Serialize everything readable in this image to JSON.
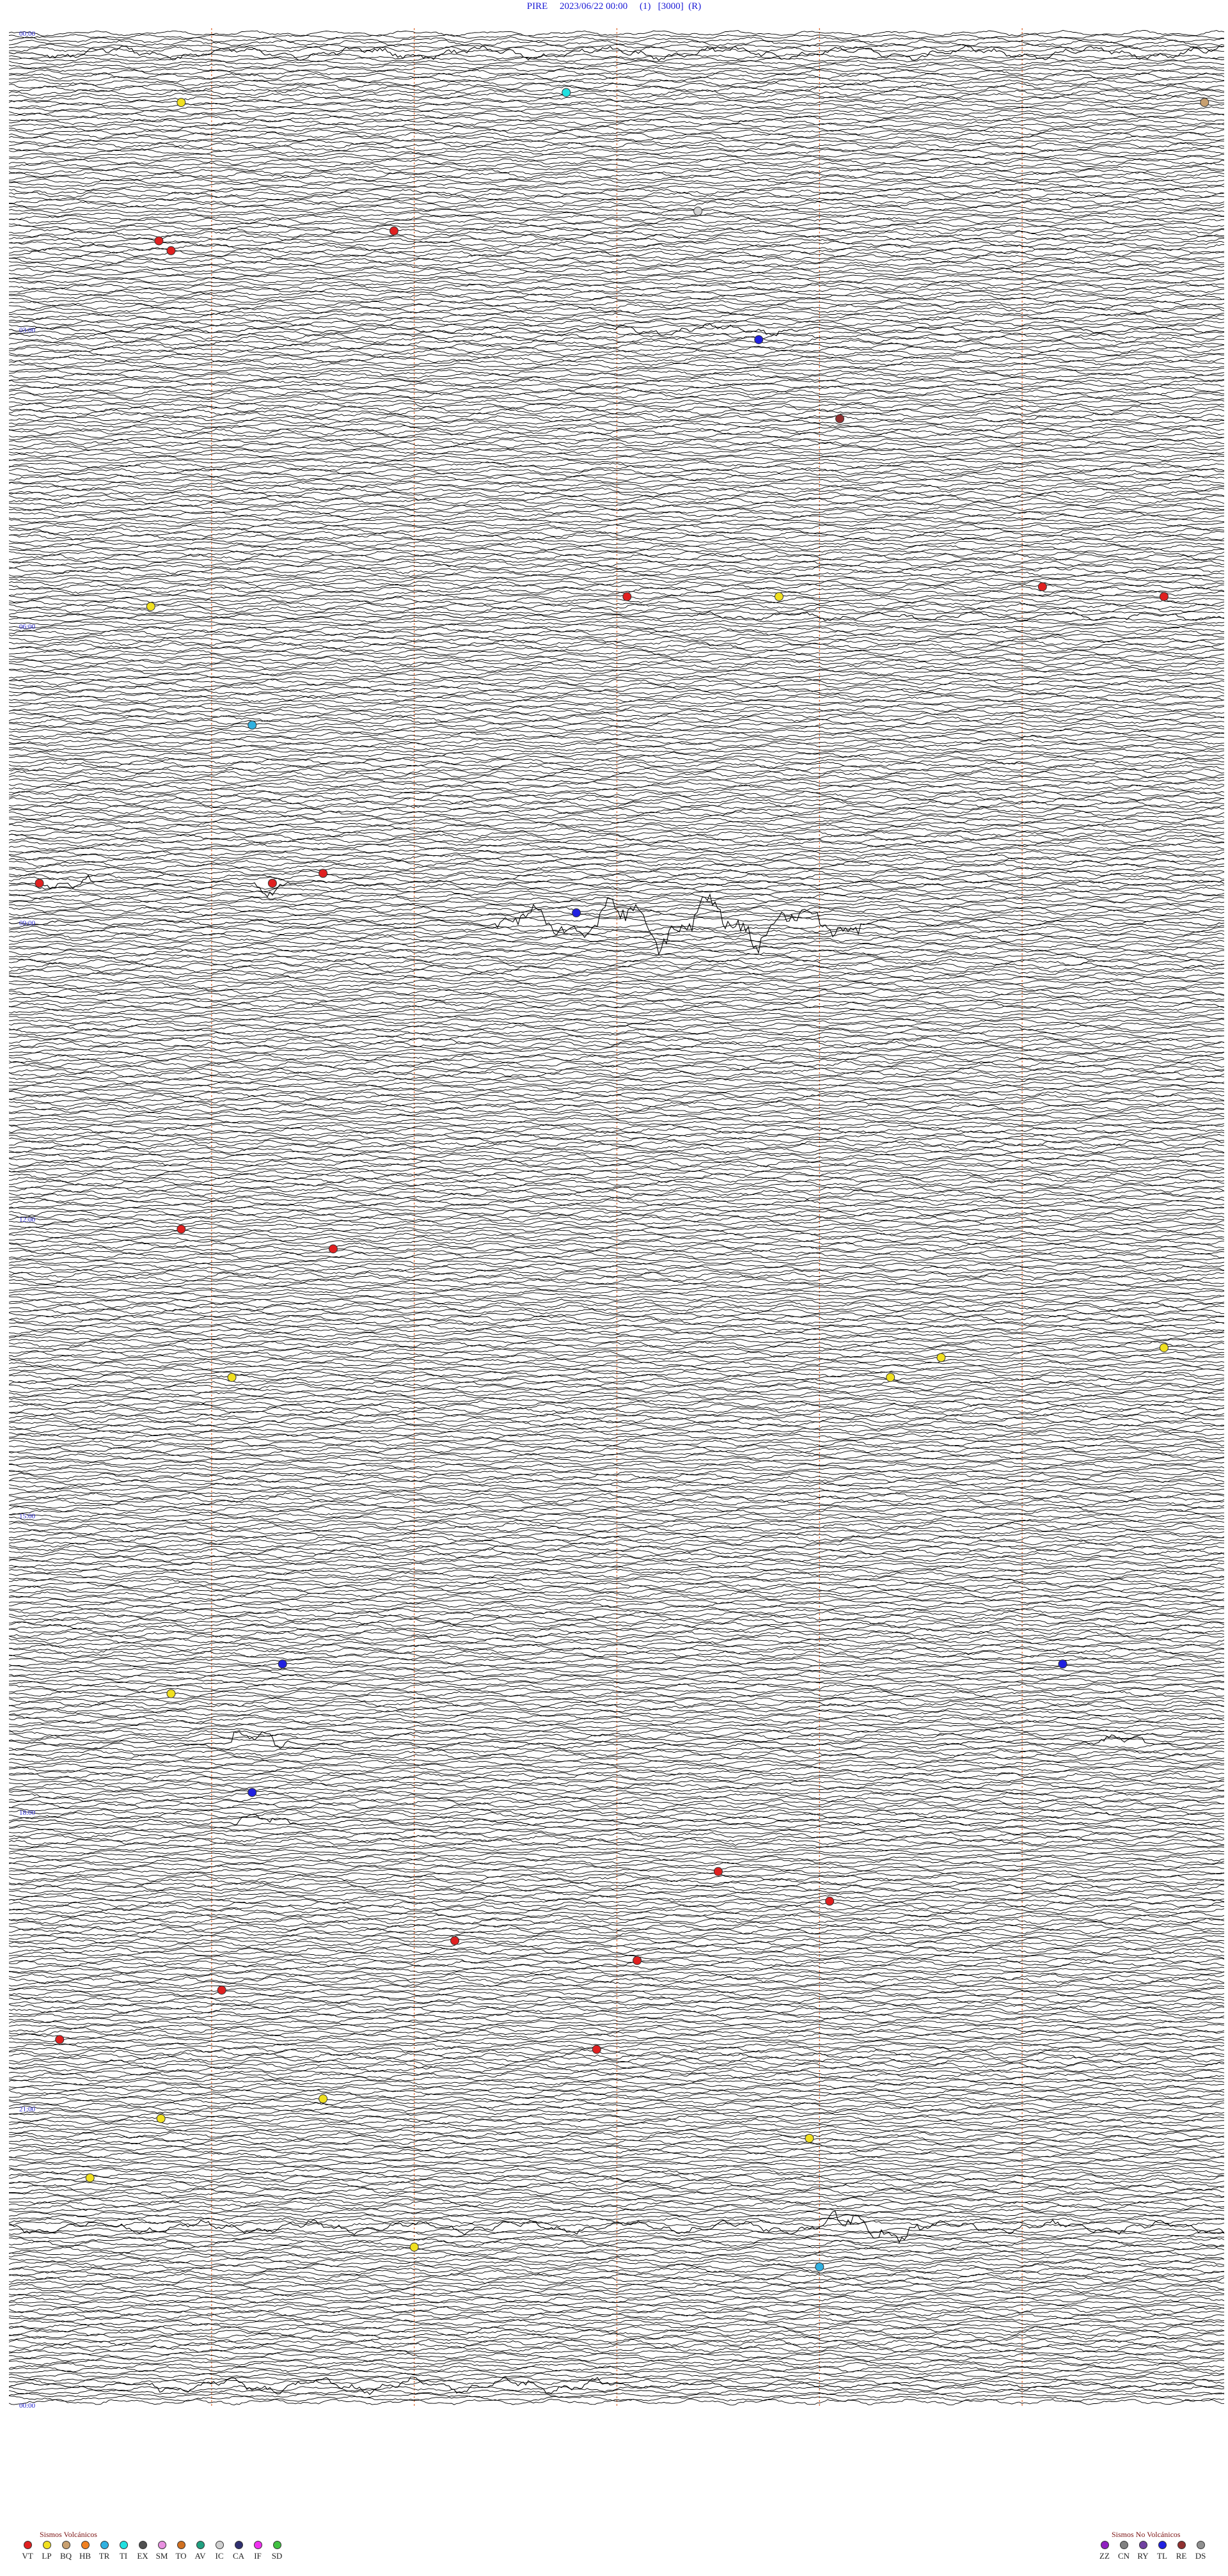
{
  "header": {
    "station": "PIRE",
    "datetime": "2023/06/22 00:00",
    "channel": "(1)",
    "gain": "[3000]",
    "mode": "(R)"
  },
  "chart_data": {
    "type": "seismogram-helicorder",
    "hour_labels": [
      "00:00",
      "03:00",
      "06:00",
      "09:00",
      "12:00",
      "15:00",
      "18:00",
      "21:00",
      "00:00"
    ],
    "grid_color": "#e0703a",
    "trace_color": "#000000",
    "events": [
      {
        "hour": 0.6,
        "minute": 27.5,
        "type": "TI"
      },
      {
        "hour": 0.7,
        "minute": 8.5,
        "type": "LP"
      },
      {
        "hour": 0.7,
        "minute": 59.0,
        "type": "BQ"
      },
      {
        "hour": 2.1,
        "minute": 7.4,
        "type": "VT"
      },
      {
        "hour": 2.2,
        "minute": 8.0,
        "type": "VT"
      },
      {
        "hour": 2.0,
        "minute": 19.0,
        "type": "VT"
      },
      {
        "hour": 1.8,
        "minute": 34.0,
        "type": "IC"
      },
      {
        "hour": 3.1,
        "minute": 37.0,
        "type": "TL"
      },
      {
        "hour": 3.9,
        "minute": 41.0,
        "type": "RE"
      },
      {
        "hour": 5.6,
        "minute": 51.0,
        "type": "VT"
      },
      {
        "hour": 5.7,
        "minute": 38.0,
        "type": "LP"
      },
      {
        "hour": 5.8,
        "minute": 7.0,
        "type": "LP"
      },
      {
        "hour": 5.7,
        "minute": 57.0,
        "type": "VT"
      },
      {
        "hour": 5.7,
        "minute": 30.5,
        "type": "VT"
      },
      {
        "hour": 7.0,
        "minute": 12.0,
        "type": "TR"
      },
      {
        "hour": 8.6,
        "minute": 1.5,
        "type": "VT"
      },
      {
        "hour": 8.6,
        "minute": 13.0,
        "type": "VT"
      },
      {
        "hour": 8.5,
        "minute": 15.5,
        "type": "VT"
      },
      {
        "hour": 8.9,
        "minute": 28.0,
        "type": "TL"
      },
      {
        "hour": 12.1,
        "minute": 8.5,
        "type": "VT"
      },
      {
        "hour": 12.3,
        "minute": 16.0,
        "type": "VT"
      },
      {
        "hour": 13.3,
        "minute": 57.0,
        "type": "LP"
      },
      {
        "hour": 13.4,
        "minute": 46.0,
        "type": "LP"
      },
      {
        "hour": 13.6,
        "minute": 11.0,
        "type": "LP"
      },
      {
        "hour": 13.6,
        "minute": 43.5,
        "type": "LP"
      },
      {
        "hour": 16.5,
        "minute": 13.5,
        "type": "TL"
      },
      {
        "hour": 16.5,
        "minute": 52.0,
        "type": "TL"
      },
      {
        "hour": 16.8,
        "minute": 8.0,
        "type": "LP"
      },
      {
        "hour": 17.8,
        "minute": 12.0,
        "type": "TL"
      },
      {
        "hour": 18.6,
        "minute": 35.0,
        "type": "VT"
      },
      {
        "hour": 18.9,
        "minute": 40.5,
        "type": "VT"
      },
      {
        "hour": 19.3,
        "minute": 22.0,
        "type": "VT"
      },
      {
        "hour": 19.5,
        "minute": 31.0,
        "type": "VT"
      },
      {
        "hour": 19.8,
        "minute": 10.5,
        "type": "VT"
      },
      {
        "hour": 20.3,
        "minute": 2.5,
        "type": "VT"
      },
      {
        "hour": 20.4,
        "minute": 29.0,
        "type": "VT"
      },
      {
        "hour": 20.9,
        "minute": 15.5,
        "type": "LP"
      },
      {
        "hour": 21.1,
        "minute": 7.5,
        "type": "LP"
      },
      {
        "hour": 21.3,
        "minute": 39.5,
        "type": "LP"
      },
      {
        "hour": 21.7,
        "minute": 4.0,
        "type": "LP"
      },
      {
        "hour": 22.4,
        "minute": 20.0,
        "type": "LP"
      },
      {
        "hour": 22.6,
        "minute": 40.0,
        "type": "TR"
      }
    ],
    "bursts": [
      {
        "hour": 0.2,
        "minute_start": 2,
        "minute_end": 60,
        "amp": 2.5
      },
      {
        "hour": 3.0,
        "minute_start": 30,
        "minute_end": 38,
        "amp": 2.0
      },
      {
        "hour": 5.9,
        "minute_start": 33,
        "minute_end": 60,
        "amp": 2.0
      },
      {
        "hour": 9.0,
        "minute_start": 24,
        "minute_end": 42,
        "amp": 6.0
      },
      {
        "hour": 9.0,
        "minute_start": 29,
        "minute_end": 37,
        "amp": 10.0
      },
      {
        "hour": 8.6,
        "minute_start": 2,
        "minute_end": 4,
        "amp": 4.0
      },
      {
        "hour": 8.6,
        "minute_start": 12,
        "minute_end": 14,
        "amp": 5.0
      },
      {
        "hour": 17.3,
        "minute_start": 11,
        "minute_end": 14,
        "amp": 6.0
      },
      {
        "hour": 17.3,
        "minute_start": 53,
        "minute_end": 56,
        "amp": 4.0
      },
      {
        "hour": 18.1,
        "minute_start": 11,
        "minute_end": 14,
        "amp": 3.0
      },
      {
        "hour": 22.2,
        "minute_start": 0,
        "minute_end": 60,
        "amp": 3.0
      },
      {
        "hour": 22.2,
        "minute_start": 40,
        "minute_end": 45,
        "amp": 7.0
      },
      {
        "hour": 23.8,
        "minute_start": 7,
        "minute_end": 30,
        "amp": 3.0
      }
    ]
  },
  "legend_volcanic": {
    "title": "Sismos Volcánicos",
    "items": [
      {
        "code": "VT",
        "color": "#e02020"
      },
      {
        "code": "LP",
        "color": "#f0e020"
      },
      {
        "code": "BQ",
        "color": "#c8a070"
      },
      {
        "code": "HB",
        "color": "#f08020"
      },
      {
        "code": "TR",
        "color": "#30b0e0"
      },
      {
        "code": "TI",
        "color": "#20e0e0"
      },
      {
        "code": "EX",
        "color": "#505050"
      },
      {
        "code": "SM",
        "color": "#e890e0"
      },
      {
        "code": "TO",
        "color": "#d07020"
      },
      {
        "code": "AV",
        "color": "#20a080"
      },
      {
        "code": "IC",
        "color": "#d0d0d0"
      },
      {
        "code": "CA",
        "color": "#303070"
      },
      {
        "code": "IF",
        "color": "#f030f0"
      },
      {
        "code": "SD",
        "color": "#40c040"
      }
    ]
  },
  "legend_nonvolcanic": {
    "title": "Sismos No Volcánicos",
    "items": [
      {
        "code": "ZZ",
        "color": "#9020c0"
      },
      {
        "code": "CN",
        "color": "#808080"
      },
      {
        "code": "RY",
        "color": "#7040a0"
      },
      {
        "code": "TL",
        "color": "#2020e0"
      },
      {
        "code": "RE",
        "color": "#903030"
      },
      {
        "code": "DS",
        "color": "#909090"
      }
    ]
  }
}
